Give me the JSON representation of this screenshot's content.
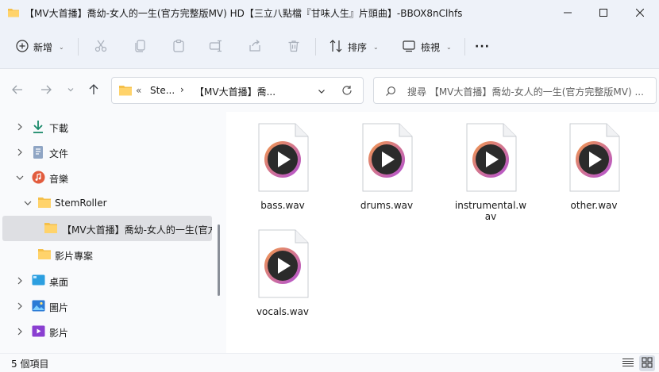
{
  "window": {
    "title": "【MV大首播】喬幼-女人的一生(官方完整版MV) HD【三立八點檔『甘味人生』片頭曲】-BBOX8nClhfs",
    "controls": [
      "minimize",
      "maximize",
      "close"
    ]
  },
  "toolbar": {
    "new_label": "新增",
    "sort_label": "排序",
    "view_label": "檢視",
    "more_label": "···"
  },
  "address": {
    "crumbs": [
      "«",
      "Ste...",
      "›",
      "【MV大首播】喬..."
    ],
    "search_placeholder": "搜尋 【MV大首播】喬幼-女人的一生(官方完整版MV) ..."
  },
  "sidebar": {
    "items": [
      {
        "label": "下載",
        "icon": "download-icon",
        "expander": "collapsed"
      },
      {
        "label": "文件",
        "icon": "document-icon",
        "expander": "collapsed"
      },
      {
        "label": "音樂",
        "icon": "music-icon",
        "expander": "expanded"
      },
      {
        "label": "StemRoller",
        "icon": "folder-icon",
        "expander": "expanded"
      },
      {
        "label": "【MV大首播】喬幼-女人的一生(官方",
        "icon": "folder-icon",
        "expander": "none",
        "selected": true
      },
      {
        "label": "影片專案",
        "icon": "folder-icon",
        "expander": "none"
      },
      {
        "label": "桌面",
        "icon": "desktop-icon",
        "expander": "collapsed"
      },
      {
        "label": "圖片",
        "icon": "pictures-icon",
        "expander": "collapsed"
      },
      {
        "label": "影片",
        "icon": "videos-icon",
        "expander": "collapsed"
      }
    ]
  },
  "files": [
    {
      "name": "bass.wav"
    },
    {
      "name": "drums.wav"
    },
    {
      "name": "instrumental.wav"
    },
    {
      "name": "other.wav"
    },
    {
      "name": "vocals.wav"
    }
  ],
  "status": {
    "count": "5 個項目"
  },
  "colors": {
    "chrome": "#eef2f9",
    "accent": "#0067c0",
    "folder": "#f5c04a",
    "play_ring_start": "#f2994a",
    "play_ring_end": "#b14fd8"
  }
}
